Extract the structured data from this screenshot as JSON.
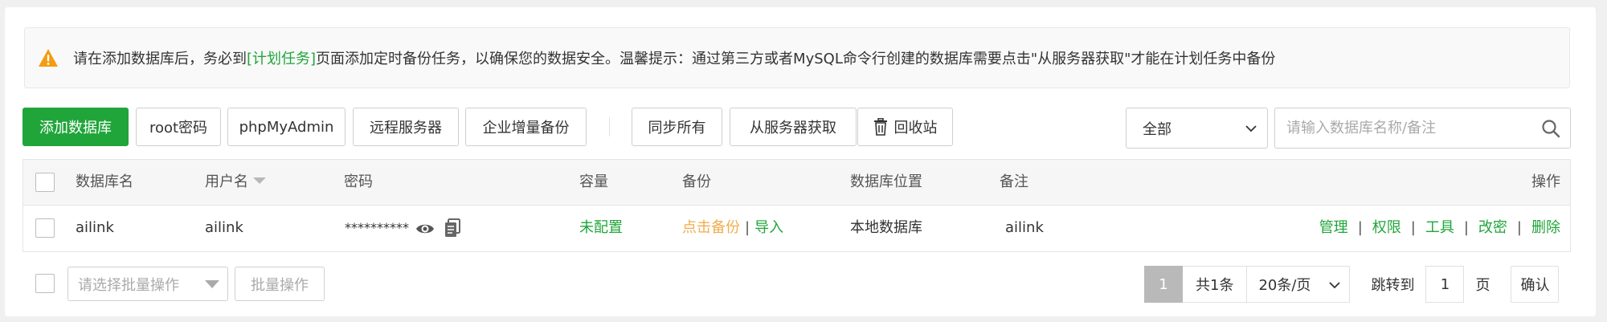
{
  "notice": {
    "text_before": "请在添加数据库后，务必到",
    "link": "[计划任务]",
    "text_after": "页面添加定时备份任务，以确保您的数据安全。温馨提示：通过第三方或者MySQL命令行创建的数据库需要点击\"从服务器获取\"才能在计划任务中备份",
    "icon": "warning-icon",
    "icon_color": "#f39c12"
  },
  "toolbar": {
    "add_db": "添加数据库",
    "root_pwd": "root密码",
    "phpmyadmin": "phpMyAdmin",
    "remote_server": "远程服务器",
    "enterprise_backup": "企业增量备份",
    "sync_all": "同步所有",
    "fetch_from_server": "从服务器获取",
    "recycle_bin": "回收站",
    "filter_value": "全部",
    "search_placeholder": "请输入数据库名称/备注"
  },
  "table": {
    "headers": {
      "name": "数据库名",
      "user": "用户名",
      "password": "密码",
      "capacity": "容量",
      "backup": "备份",
      "location": "数据库位置",
      "remark": "备注",
      "actions": "操作"
    },
    "rows": [
      {
        "name": "ailink",
        "user": "ailink",
        "password": "**********",
        "capacity": "未配置",
        "backup_link": "点击备份",
        "separator": "|",
        "import_link": "导入",
        "location": "本地数据库",
        "remark": "ailink",
        "actions": [
          "管理",
          "权限",
          "工具",
          "改密",
          "删除"
        ]
      }
    ]
  },
  "footer": {
    "batch_placeholder": "请选择批量操作",
    "batch_button": "批量操作",
    "current_page": "1",
    "total": "共1条",
    "page_size": "20条/页",
    "jump_label": "跳转到",
    "jump_value": "1",
    "page_unit": "页",
    "confirm": "确认"
  },
  "colors": {
    "accent": "#20a53a",
    "backup_link": "#f0ad4e"
  }
}
